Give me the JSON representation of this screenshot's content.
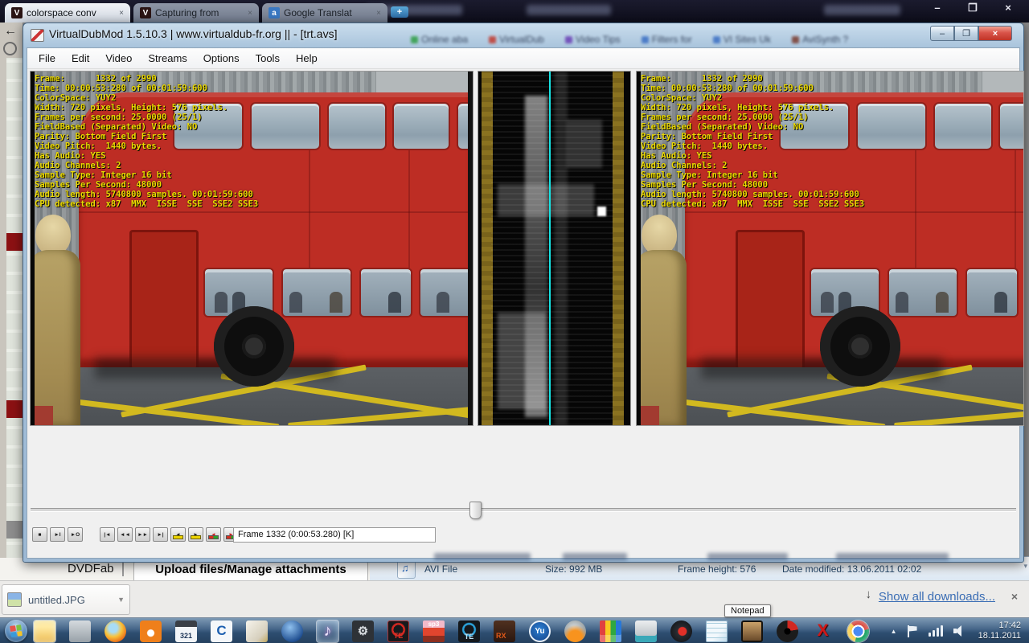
{
  "browser": {
    "tabs": [
      {
        "label": "colorspace conv",
        "close": "×",
        "icon": "videohelp-favicon",
        "fav": "V",
        "favbg": "#2a1414",
        "favfg": "#ffffff",
        "active": true
      },
      {
        "label": "Capturing from",
        "close": "×",
        "icon": "videohelp-favicon",
        "fav": "V",
        "favbg": "#2a1414",
        "favfg": "#ffffff"
      },
      {
        "label": "Google Translat",
        "close": "×",
        "icon": "google-translate-favicon",
        "fav": "a",
        "favbg": "#3a78c2",
        "favfg": "#ffffff"
      }
    ],
    "new_tab_label": "+",
    "window_controls": {
      "minimize": "–",
      "restore": "❐",
      "close": "×"
    },
    "bookmarks": [
      {
        "label": "Online aba",
        "color": "#2f9e44"
      },
      {
        "label": "VirtualDub",
        "color": "#c23a2f"
      },
      {
        "label": "Video Tips",
        "color": "#6a3fb5"
      },
      {
        "label": "Filters for",
        "color": "#3b6fc4"
      },
      {
        "label": "VI Sites Uk",
        "color": "#3b6fc4"
      },
      {
        "label": "AviSynth ?",
        "color": "#7a3b2f"
      }
    ],
    "back_glyph": "←"
  },
  "vdub": {
    "title": "VirtualDubMod 1.5.10.3 | www.virtualdub-fr.org || - [trt.avs]",
    "window_controls": {
      "minimize": "–",
      "maximize": "❐",
      "close": "×"
    },
    "menus": [
      "File",
      "Edit",
      "Video",
      "Streams",
      "Options",
      "Tools",
      "Help"
    ],
    "overlay_lines": [
      "Frame:      1332 of 2990",
      "Time: 00:00:53:280 of 00:01:59:600",
      "ColorSpace: YUY2",
      "Width: 720 pixels, Height: 576 pixels.",
      "Frames per second: 25.0000 (25/1)",
      "FieldBased (Separated) Video: NO",
      "Parity: Bottom Field First",
      "Video Pitch:  1440 bytes.",
      "Has Audio: YES",
      "Audio Channels: 2",
      "Sample Type: Integer 16 bit",
      "Samples Per Second: 48000",
      "Audio length: 5740800 samples. 00:01:59:600",
      "CPU detected: x87  MMX  ISSE  SSE  SSE2 SSE3"
    ],
    "overlay_color": "#ecda00",
    "controls": [
      {
        "glyph": "■",
        "name": "stop-button"
      },
      {
        "glyph": "►I",
        "name": "play-input-button"
      },
      {
        "glyph": "►O",
        "name": "play-output-button"
      },
      {
        "glyph": "|◄",
        "cls": "g",
        "name": "goto-start-button"
      },
      {
        "glyph": "◄◄",
        "name": "step-back-button"
      },
      {
        "glyph": "►►",
        "name": "step-forward-button"
      },
      {
        "glyph": "►|",
        "name": "goto-end-button"
      },
      {
        "glyph": "◄",
        "cls": "btn-key",
        "name": "prev-keyframe-button"
      },
      {
        "glyph": "►",
        "cls": "btn-key",
        "name": "next-keyframe-button"
      },
      {
        "glyph": "◄",
        "cls": "btn-scene",
        "name": "prev-scene-button"
      },
      {
        "glyph": "►",
        "cls": "btn-scene",
        "name": "next-scene-button"
      },
      {
        "glyph": "◄",
        "cls": "g",
        "name": "mark-in-button"
      },
      {
        "glyph": "►",
        "name": "mark-out-button"
      }
    ],
    "status": "Frame 1332 (0:00:53.280) [K]"
  },
  "page_behind": {
    "dvdfab": "DVDFab",
    "upload_heading": "Upload files/Manage attachments"
  },
  "explorer": {
    "file_type": "AVI File",
    "fields": [
      {
        "label": "Size:",
        "value": "992 MB"
      },
      {
        "label": "Frame height:",
        "value": "576"
      },
      {
        "label": "Date modified:",
        "value": "13.06.2011 02:02"
      }
    ]
  },
  "downloads": {
    "item_name": "untitled.JPG",
    "caret": "▼",
    "arrow": "↓",
    "show_all": "Show all downloads...",
    "close": "×"
  },
  "tooltip": {
    "text": "Notepad"
  },
  "taskbar": {
    "icons": [
      {
        "name": "windows-explorer-icon",
        "cls": "tb-explorer",
        "active": true
      },
      {
        "name": "drive-utility-icon",
        "cls": "tb-drive"
      },
      {
        "name": "firefox-icon",
        "cls": "tb-firefox"
      },
      {
        "name": "feeddemon-icon",
        "cls": "tb-feed"
      },
      {
        "name": "media-player-classic-icon",
        "cls": "tb-mpc",
        "glyph": "321"
      },
      {
        "name": "comodo-icon",
        "cls": "tb-comodo",
        "glyph": "C"
      },
      {
        "name": "mail-icon",
        "cls": "tb-mail"
      },
      {
        "name": "blue-orb-app-icon",
        "cls": "tb-orbblue"
      },
      {
        "name": "music-app-icon",
        "cls": "tb-music",
        "glyph": "♪",
        "active": true
      },
      {
        "name": "gears-app-icon",
        "cls": "tb-gears",
        "glyph": "⚙"
      },
      {
        "name": "te-dial-app-icon",
        "cls": "tb-te",
        "glyph": "TE"
      },
      {
        "name": "sp3-app-icon",
        "cls": "tb-sp3",
        "glyph": "sp3"
      },
      {
        "name": "qte-dial-app-icon",
        "cls": "tb-qte",
        "glyph": "TE"
      },
      {
        "name": "rx-app-icon",
        "cls": "tb-rx",
        "glyph": "RX"
      },
      {
        "name": "yu-app-icon",
        "cls": "tb-yu",
        "glyph": "Yu"
      },
      {
        "name": "fire-globe-app-icon",
        "cls": "tb-fire"
      },
      {
        "name": "color-blocks-app-icon",
        "cls": "tb-blocks"
      },
      {
        "name": "scanner-app-icon",
        "cls": "tb-scan"
      },
      {
        "name": "red-dial-app-icon",
        "cls": "tb-dial2"
      },
      {
        "name": "notepad-icon",
        "cls": "tb-notepad"
      },
      {
        "name": "image-viewer-icon",
        "cls": "tb-pic"
      },
      {
        "name": "disc-app-icon",
        "cls": "tb-disc"
      },
      {
        "name": "red-x-app-icon",
        "cls": "tb-redx",
        "glyph": "X"
      },
      {
        "name": "chrome-icon",
        "cls": "tb-chrome",
        "active": true
      }
    ],
    "clock_time": "17:42",
    "clock_date": "18.11.2011"
  }
}
